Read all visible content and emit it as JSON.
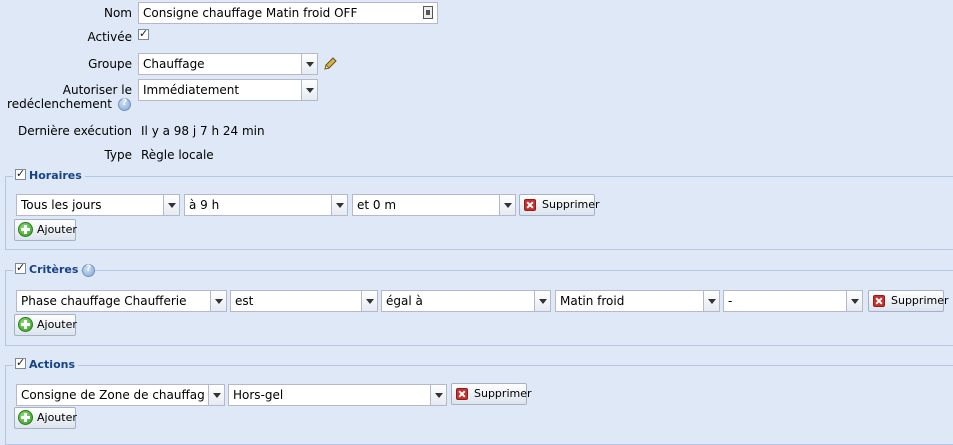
{
  "form": {
    "nom_label": "Nom",
    "nom_value": "Consigne chauffage Matin froid OFF",
    "activee_label": "Activée",
    "groupe_label": "Groupe",
    "groupe_value": "Chauffage",
    "autoriser_label_line1": "Autoriser le",
    "autoriser_label_line2": "redéclenchement",
    "autoriser_value": "Immédiatement",
    "derniere_label": "Dernière exécution",
    "derniere_value": "Il y a 98 j 7 h 24 min",
    "type_label": "Type",
    "type_value": "Règle locale"
  },
  "horaires": {
    "title": "Horaires",
    "day": "Tous les jours",
    "hour": "à 9 h",
    "minute": "et 0 m",
    "delete_label": "Supprimer",
    "add_label": "Ajouter"
  },
  "criteres": {
    "title": "Critères",
    "field": "Phase chauffage Chaufferie",
    "op1": "est",
    "op2": "égal à",
    "value": "Matin froid",
    "extra": "-",
    "delete_label": "Supprimer",
    "add_label": "Ajouter"
  },
  "actions": {
    "title": "Actions",
    "target": "Consigne de Zone de chauffage C",
    "value": "Hors-gel",
    "delete_label": "Supprimer",
    "add_label": "Ajouter"
  }
}
